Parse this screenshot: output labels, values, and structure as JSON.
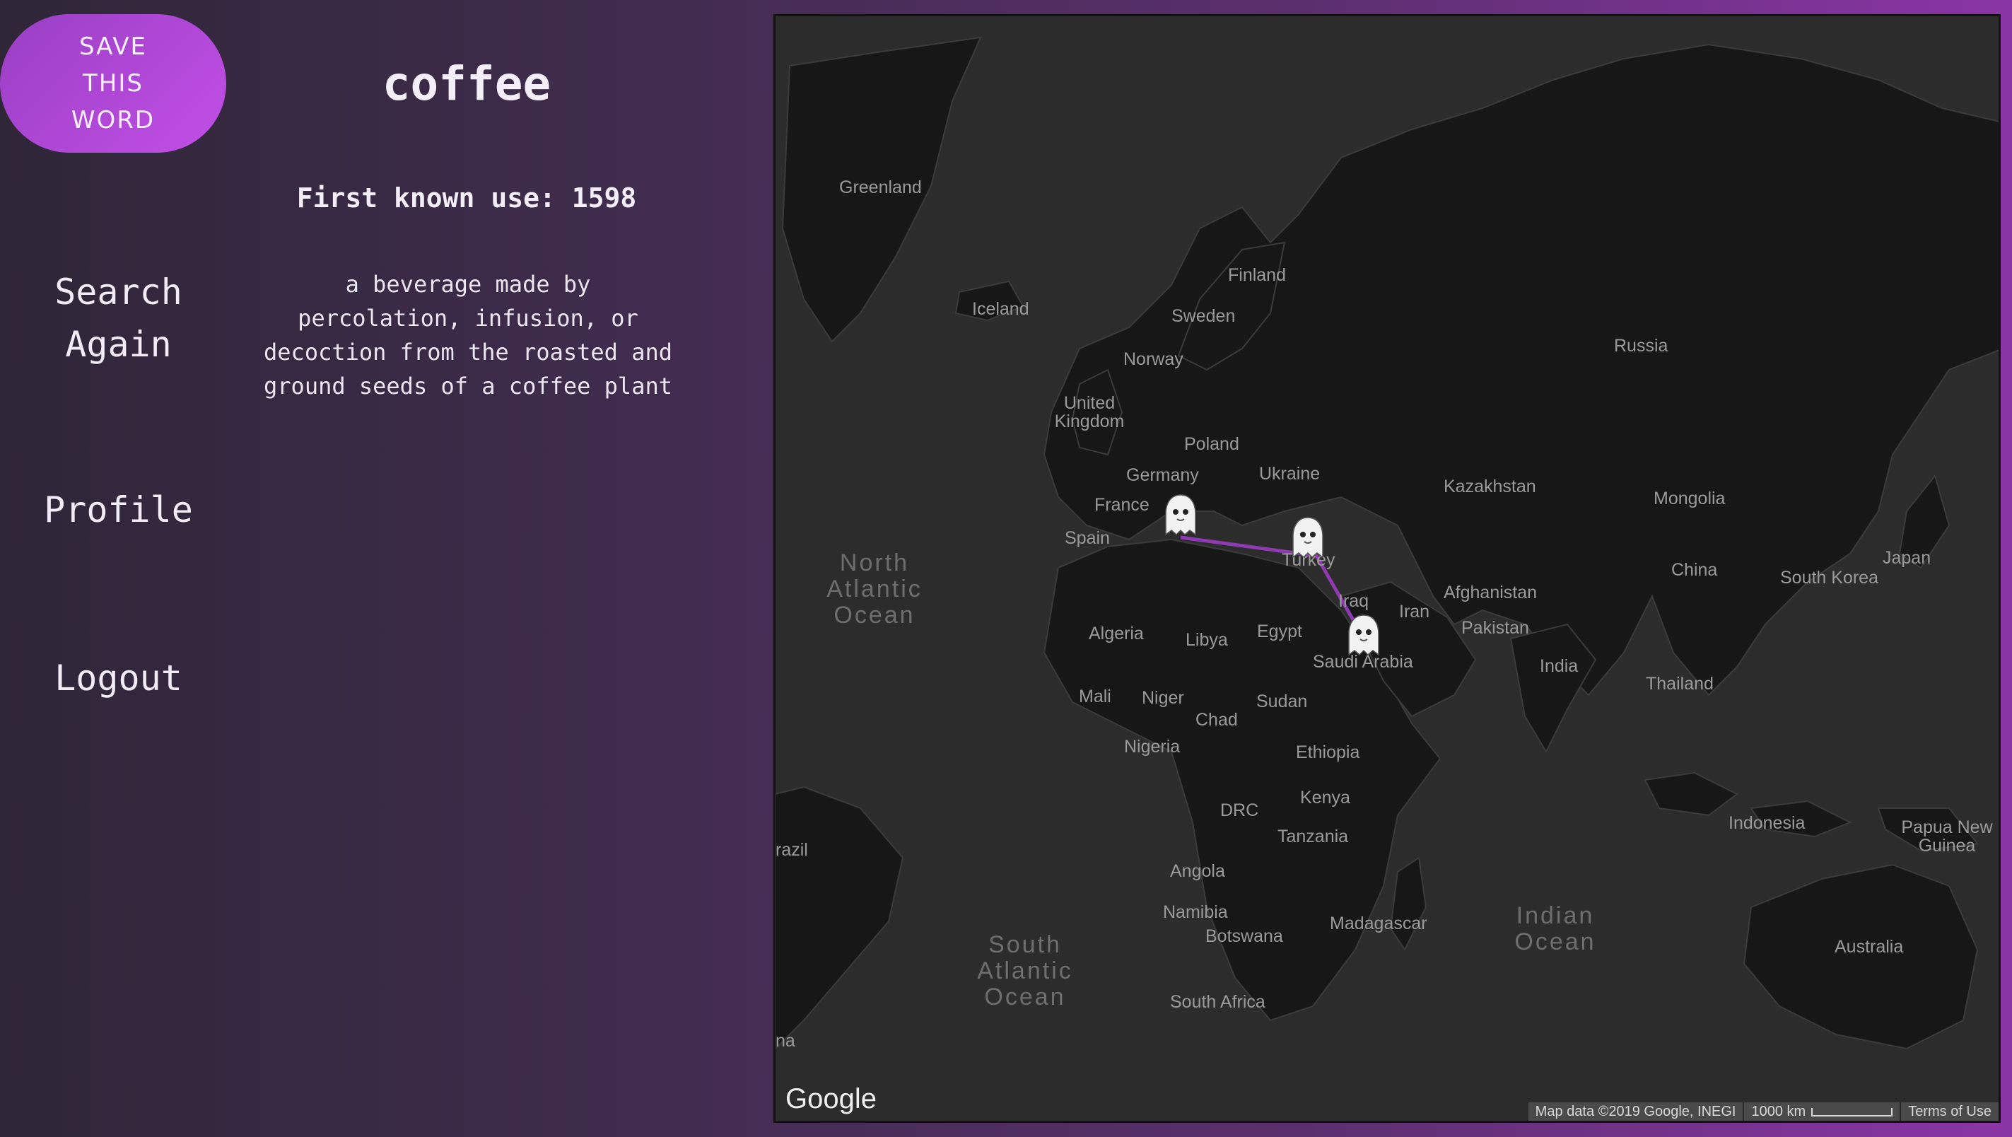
{
  "save_button": {
    "label": "SAVE THIS WORD"
  },
  "nav": {
    "search_again": "Search Again",
    "profile": "Profile",
    "logout": "Logout"
  },
  "word": {
    "title": "coffee",
    "first_use": "First known use: 1598",
    "definition": "a beverage made by percolation, infusion, or decoction from the roasted and ground seeds of a coffee plant"
  },
  "map": {
    "labels": {
      "greenland": "Greenland",
      "iceland": "Iceland",
      "finland": "Finland",
      "sweden": "Sweden",
      "norway": "Norway",
      "russia": "Russia",
      "united_kingdom": "United Kingdom",
      "poland": "Poland",
      "germany": "Germany",
      "ukraine": "Ukraine",
      "france": "France",
      "spain": "Spain",
      "kazakhstan": "Kazakhstan",
      "mongolia": "Mongolia",
      "turkey": "Turkey",
      "iraq": "Iraq",
      "iran": "Iran",
      "afghanistan": "Afghanistan",
      "pakistan": "Pakistan",
      "china": "China",
      "south_korea": "South Korea",
      "japan": "Japan",
      "algeria": "Algeria",
      "libya": "Libya",
      "egypt": "Egypt",
      "saudi_arabia": "Saudi Arabia",
      "india": "India",
      "thailand": "Thailand",
      "mali": "Mali",
      "niger": "Niger",
      "chad": "Chad",
      "sudan": "Sudan",
      "nigeria": "Nigeria",
      "ethiopia": "Ethiopia",
      "kenya": "Kenya",
      "drc": "DRC",
      "tanzania": "Tanzania",
      "angola": "Angola",
      "namibia": "Namibia",
      "botswana": "Botswana",
      "madagascar": "Madagascar",
      "south_africa": "South Africa",
      "brazil": "razil",
      "indonesia": "Indonesia",
      "papua_new_guinea": "Papua New Guinea",
      "australia": "Australia",
      "edge_na": "na"
    },
    "oceans": {
      "north_atlantic": "North Atlantic Ocean",
      "south_atlantic": "South Atlantic Ocean",
      "indian": "Indian Ocean"
    },
    "route_color": "#8e3ab0",
    "markers": [
      "Italy",
      "Turkey",
      "Yemen"
    ],
    "logo": "Google",
    "attribution": "Map data ©2019 Google, INEGI",
    "scale": "1000 km",
    "terms": "Terms of Use"
  }
}
